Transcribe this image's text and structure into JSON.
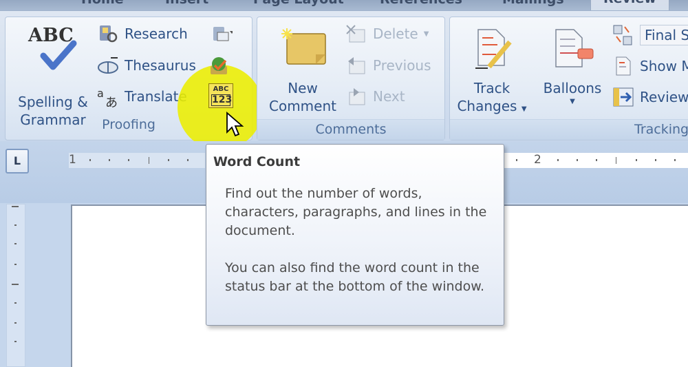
{
  "tabs": [
    {
      "label": "Home",
      "active": false
    },
    {
      "label": "Insert",
      "active": false
    },
    {
      "label": "Page Layout",
      "active": false
    },
    {
      "label": "References",
      "active": false
    },
    {
      "label": "Mailings",
      "active": false
    },
    {
      "label": "Review",
      "active": true
    }
  ],
  "ribbon": {
    "proofing": {
      "label": "Proofing",
      "spelling_grammar": "Spelling & Grammar",
      "spelling_icon_text": "ABC",
      "research": "Research",
      "thesaurus": "Thesaurus",
      "translate": "Translate",
      "word_count_icon_top": "ABC",
      "word_count_icon_bottom": "123"
    },
    "comments": {
      "label": "Comments",
      "new_comment": "New Comment",
      "delete": "Delete",
      "previous": "Previous",
      "next": "Next"
    },
    "tracking": {
      "label": "Tracking",
      "track_changes": "Track Changes",
      "balloons": "Balloons",
      "display_for_review": "Final S",
      "show_markup": "Show M",
      "reviewing_pane": "Review"
    }
  },
  "ruler": {
    "tab_selector": "L",
    "left_number": "1",
    "right_number": "2"
  },
  "tooltip": {
    "title": "Word Count",
    "paragraph1": "Find out the number of words, characters, paragraphs, and lines in the document.",
    "paragraph2": "You can also find the word count in the status bar at the bottom of the window."
  },
  "colors": {
    "highlight": "#ecee00",
    "ribbon_text": "#2f5286",
    "disabled_text": "#a8b5c6"
  }
}
